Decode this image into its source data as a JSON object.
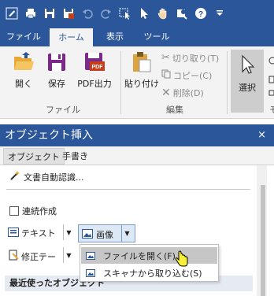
{
  "colors": {
    "accent": "#2b579a",
    "ribbon_bg": "#f3f3f3",
    "pdf_red": "#c43e1c"
  },
  "quick_access": {
    "icons": [
      "app-icon",
      "print-icon",
      "save-icon",
      "save-pdf-icon",
      "undo-icon",
      "redo-icon",
      "pointer-select-icon",
      "arrow-cursor-icon",
      "hand-icon",
      "zoom-icon",
      "help-icon",
      "customize-dropdown-icon"
    ]
  },
  "tabs": [
    {
      "label": "ファイル",
      "active": false
    },
    {
      "label": "ホーム",
      "active": true
    },
    {
      "label": "表示",
      "active": false
    },
    {
      "label": "ツール",
      "active": false
    }
  ],
  "ribbon": {
    "file_group": {
      "label": "ファイル",
      "buttons": [
        {
          "label": "開く",
          "icon": "folder-open-icon"
        },
        {
          "label": "保存",
          "icon": "save-icon"
        },
        {
          "label": "PDF出力",
          "icon": "pdf-export-icon"
        }
      ]
    },
    "edit_group": {
      "label": "編集",
      "paste": {
        "label": "貼り付け",
        "icon": "paste-icon"
      },
      "cut": {
        "label": "切り取り(T)",
        "icon": "scissors-icon"
      },
      "copy": {
        "label": "コピー(C)",
        "icon": "copy-icon"
      },
      "delete": {
        "label": "削除(D)",
        "icon": "delete-x-icon"
      }
    },
    "select": {
      "label": "選択",
      "icon": "arrow-cursor-icon"
    },
    "cut_off_group_label": "モ"
  },
  "task_pane": {
    "title": "オブジェクト挿入",
    "close": "×",
    "tabs": [
      {
        "label": "オブジェクト",
        "active": true
      },
      {
        "label": "手書き",
        "active": false
      }
    ],
    "auto_recognize": "文書自動認識...",
    "continuous_create": "連続作成",
    "text_button": "テキスト",
    "image_button": "画像",
    "correction_button": "修正テー",
    "image_menu": [
      {
        "label": "ファイルを開く(F)",
        "highlighted": true
      },
      {
        "label": "スキャナから取り込む(S)",
        "highlighted": false
      }
    ],
    "recent_header": "最近使ったオブジェクト"
  }
}
